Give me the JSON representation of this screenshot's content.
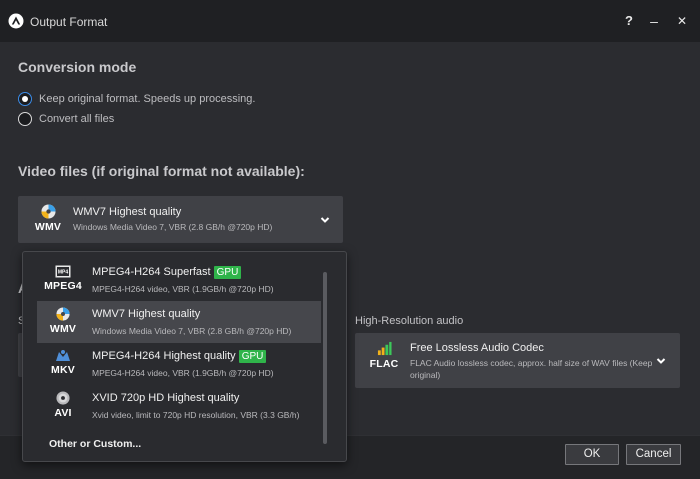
{
  "window": {
    "title": "Output Format",
    "help": "?",
    "minimize": "–",
    "close": "✕"
  },
  "conversion_mode": {
    "heading": "Conversion mode",
    "options": [
      {
        "label": "Keep original format. Speeds up processing.",
        "checked": true
      },
      {
        "label": "Convert all files",
        "checked": false
      }
    ]
  },
  "video": {
    "heading": "Video files (if original format not available):",
    "selected": {
      "ext": "WMV",
      "name": "WMV7 Highest quality",
      "desc": "Windows Media Video 7, VBR (2.8 GB/h @720p HD)",
      "icon": "wmv-disc-icon"
    }
  },
  "partial": {
    "heading_fragment": "A",
    "label_fragment": "S"
  },
  "audio": {
    "label": "High-Resolution audio",
    "selected": {
      "ext": "FLAC",
      "name": "Free Lossless Audio Codec",
      "desc_line1": "FLAC Audio lossless codec, approx. half size of WAV files (Keep",
      "desc_line2": "original)",
      "icon": "flac-level-icon"
    }
  },
  "dropdown": {
    "items": [
      {
        "ext": "MPEG4",
        "name": "MPEG4-H264 Superfast",
        "badge": "GPU",
        "desc": "MPEG4-H264 video, VBR (1.9GB/h @720p HD)",
        "selected": false,
        "icon": "mpeg4-film-icon"
      },
      {
        "ext": "WMV",
        "name": "WMV7 Highest quality",
        "badge": "",
        "desc": "Windows Media Video 7, VBR (2.8 GB/h @720p HD)",
        "selected": true,
        "icon": "wmv-disc-icon"
      },
      {
        "ext": "MKV",
        "name": "MPEG4-H264 Highest quality",
        "badge": "GPU",
        "desc": "MPEG4-H264 video, VBR (1.9GB/h @720p HD)",
        "selected": false,
        "icon": "mkv-matroska-icon"
      },
      {
        "ext": "AVI",
        "name": "XVID 720p HD Highest quality",
        "badge": "",
        "desc": "Xvid video, limit to 720p HD resolution, VBR (3.3 GB/h)",
        "selected": false,
        "icon": "avi-disc-icon"
      }
    ],
    "other": "Other or Custom..."
  },
  "buttons": {
    "ok": "OK",
    "cancel": "Cancel"
  },
  "colors": {
    "accent": "#3c8ce7",
    "gpu_badge": "#2fb44a",
    "panel": "#404146",
    "background": "#2b2c30"
  }
}
